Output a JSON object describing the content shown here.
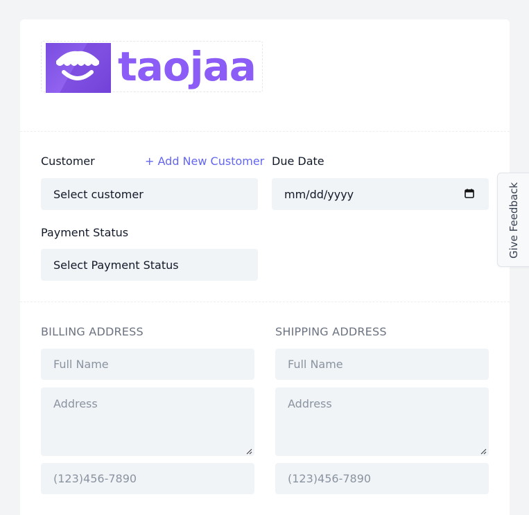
{
  "brand": {
    "name": "taojaa",
    "logo_icon": "awning-store-icon",
    "accent_color": "#8b5cf6"
  },
  "invoice_form": {
    "customer": {
      "label": "Customer",
      "add_link": "+ Add New Customer",
      "placeholder": "Select customer"
    },
    "due_date": {
      "label": "Due Date",
      "placeholder": "mm/dd/yyyy",
      "icon": "calendar-icon"
    },
    "payment_status": {
      "label": "Payment Status",
      "placeholder": "Select Payment Status"
    }
  },
  "billing": {
    "heading": "BILLING ADDRESS",
    "full_name_placeholder": "Full Name",
    "address_placeholder": "Address",
    "phone_placeholder": "(123)456-7890"
  },
  "shipping": {
    "heading": "SHIPPING ADDRESS",
    "full_name_placeholder": "Full Name",
    "address_placeholder": "Address",
    "phone_placeholder": "(123)456-7890"
  },
  "feedback_tab": {
    "label": "Give Feedback"
  }
}
